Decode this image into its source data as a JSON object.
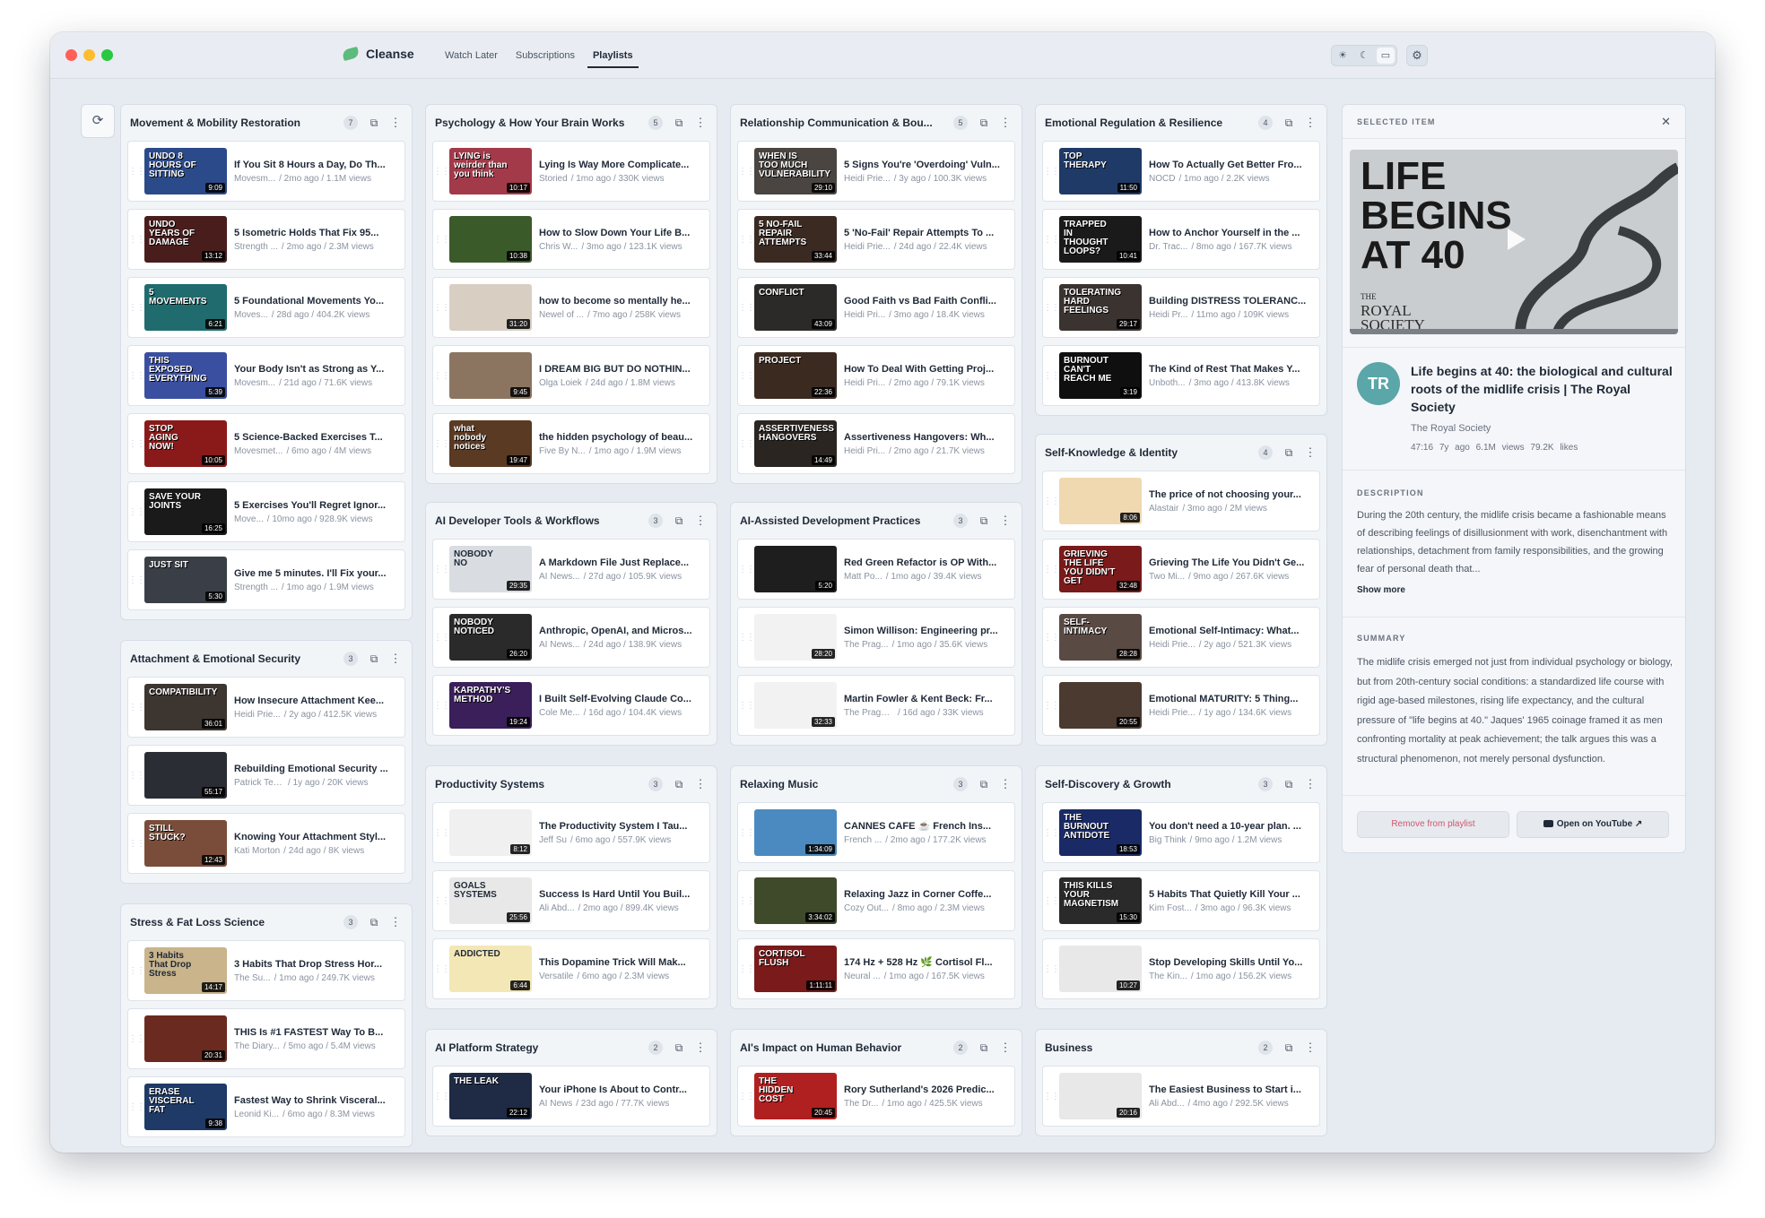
{
  "app": {
    "name": "Cleanse",
    "nav_tabs": [
      "Watch Later",
      "Subscriptions",
      "Playlists"
    ],
    "active_tab": "Playlists",
    "theme_icons": [
      "sun-icon",
      "moon-icon",
      "monitor-icon"
    ],
    "settings_icon": "gear-icon",
    "refresh_icon": "refresh-icon"
  },
  "playlists": [
    {
      "title": "Movement & Mobility Restoration",
      "count": "7",
      "items": [
        {
          "title": "If You Sit 8 Hours a Day, Do Th...",
          "channel": "Movesm...",
          "meta": "/ 2mo ago / 1.1M views",
          "duration": "9:09",
          "thumb_text": "UNDO 8 HOURS OF SITTING",
          "color": "#2b4a8a"
        },
        {
          "title": "5 Isometric Holds That Fix 95...",
          "channel": "Strength ...",
          "meta": "/ 2mo ago / 2.3M views",
          "duration": "13:12",
          "thumb_text": "UNDO YEARS OF DAMAGE",
          "color": "#4a1d1d"
        },
        {
          "title": "5 Foundational Movements Yo...",
          "channel": "Moves...",
          "meta": "/ 28d ago / 404.2K views",
          "duration": "6:21",
          "thumb_text": "5 MOVEMENTS",
          "color": "#1f6b6e"
        },
        {
          "title": "Your Body Isn't as Strong as Y...",
          "channel": "Movesm...",
          "meta": "/ 21d ago / 71.6K views",
          "duration": "5:39",
          "thumb_text": "THIS EXPOSED EVERYTHING",
          "color": "#3a4fa0"
        },
        {
          "title": "5 Science-Backed Exercises T...",
          "channel": "Movesmet...",
          "meta": "/ 6mo ago / 4M views",
          "duration": "10:05",
          "thumb_text": "STOP AGING NOW!",
          "color": "#8a1a1a"
        },
        {
          "title": "5 Exercises You'll Regret Ignor...",
          "channel": "Move...",
          "meta": "/ 10mo ago / 928.9K views",
          "duration": "16:25",
          "thumb_text": "SAVE YOUR JOINTS",
          "color": "#1a1a1a"
        },
        {
          "title": "Give me 5 minutes. I'll Fix your...",
          "channel": "Strength ...",
          "meta": "/ 1mo ago / 1.9M views",
          "duration": "5:30",
          "thumb_text": "JUST SIT",
          "color": "#3a3f47"
        }
      ]
    },
    {
      "title": "Attachment & Emotional Security",
      "count": "3",
      "items": [
        {
          "title": "How Insecure Attachment Kee...",
          "channel": "Heidi Prie...",
          "meta": "/ 2y ago / 412.5K views",
          "duration": "36:01",
          "thumb_text": "COMPATIBILITY",
          "color": "#3d3530"
        },
        {
          "title": "Rebuilding Emotional Security ...",
          "channel": "Patrick Teah...",
          "meta": "/ 1y ago / 20K views",
          "duration": "55:17",
          "thumb_text": "",
          "color": "#2a2d33"
        },
        {
          "title": "Knowing Your Attachment Styl...",
          "channel": "Kati Morton",
          "meta": "/ 24d ago / 8K views",
          "duration": "12:43",
          "thumb_text": "STILL STUCK?",
          "color": "#7a4d3a"
        }
      ]
    },
    {
      "title": "Stress & Fat Loss Science",
      "count": "3",
      "items": [
        {
          "title": "3 Habits That Drop Stress Hor...",
          "channel": "The Su...",
          "meta": "/ 1mo ago / 249.7K views",
          "duration": "14:17",
          "thumb_text": "3 Habits That Drop Stress",
          "color": "#c9b48c"
        },
        {
          "title": "THIS Is #1 FASTEST Way To B...",
          "channel": "The Diary...",
          "meta": "/ 5mo ago / 5.4M views",
          "duration": "20:31",
          "thumb_text": "",
          "color": "#6b2a20"
        },
        {
          "title": "Fastest Way to Shrink Visceral...",
          "channel": "Leonid Ki...",
          "meta": "/ 6mo ago / 8.3M views",
          "duration": "9:38",
          "thumb_text": "ERASE VISCERAL FAT",
          "color": "#1f3a66"
        }
      ]
    },
    {
      "title": "Psychology & How Your Brain Works",
      "count": "5",
      "items": [
        {
          "title": "Lying Is Way More Complicate...",
          "channel": "Storied",
          "meta": "/ 1mo ago / 330K views",
          "duration": "10:17",
          "thumb_text": "LYING is weirder than you think",
          "color": "#a33a4a"
        },
        {
          "title": "How to Slow Down Your Life B...",
          "channel": "Chris W...",
          "meta": "/ 3mo ago / 123.1K views",
          "duration": "10:38",
          "thumb_text": "",
          "color": "#3b5a2a"
        },
        {
          "title": "how to become so mentally he...",
          "channel": "Newel of ...",
          "meta": "/ 7mo ago / 258K views",
          "duration": "31:20",
          "thumb_text": "",
          "color": "#d8cfc2"
        },
        {
          "title": "I DREAM BIG BUT DO NOTHIN...",
          "channel": "Olga Loiek",
          "meta": "/ 24d ago / 1.8M views",
          "duration": "9:45",
          "thumb_text": "",
          "color": "#8c7560"
        },
        {
          "title": "the hidden psychology of beau...",
          "channel": "Five By N...",
          "meta": "/ 1mo ago / 1.9M views",
          "duration": "19:47",
          "thumb_text": "what nobody notices",
          "color": "#5a3a22"
        }
      ]
    },
    {
      "title": "AI Developer Tools & Workflows",
      "count": "3",
      "items": [
        {
          "title": "A Markdown File Just Replace...",
          "channel": "AI News...",
          "meta": "/ 27d ago / 105.9K views",
          "duration": "29:35",
          "thumb_text": "NOBODY NO",
          "color": "#d9dde2"
        },
        {
          "title": "Anthropic, OpenAI, and Micros...",
          "channel": "AI News...",
          "meta": "/ 24d ago / 138.9K views",
          "duration": "26:20",
          "thumb_text": "NOBODY NOTICED",
          "color": "#2a2a2a"
        },
        {
          "title": "I Built Self-Evolving Claude Co...",
          "channel": "Cole Me...",
          "meta": "/ 16d ago / 104.4K views",
          "duration": "19:24",
          "thumb_text": "KARPATHY'S METHOD",
          "color": "#3a1f5a"
        }
      ]
    },
    {
      "title": "Productivity Systems",
      "count": "3",
      "items": [
        {
          "title": "The Productivity System I Tau...",
          "channel": "Jeff Su",
          "meta": "/ 6mo ago / 557.9K views",
          "duration": "8:12",
          "thumb_text": "",
          "color": "#f0f0f0"
        },
        {
          "title": "Success Is Hard Until You Buil...",
          "channel": "Ali Abd...",
          "meta": "/ 2mo ago / 899.4K views",
          "duration": "25:56",
          "thumb_text": "GOALS SYSTEMS",
          "color": "#e8e8e8"
        },
        {
          "title": "This Dopamine Trick Will Mak...",
          "channel": "Versatile",
          "meta": "/ 6mo ago / 2.3M views",
          "duration": "6:44",
          "thumb_text": "ADDICTED",
          "color": "#f3e7b5"
        }
      ]
    },
    {
      "title": "AI Platform Strategy",
      "count": "2",
      "items": [
        {
          "title": "Your iPhone Is About to Contr...",
          "channel": "AI News",
          "meta": "/ 23d ago / 77.7K views",
          "duration": "22:12",
          "thumb_text": "THE LEAK",
          "color": "#1f2a44"
        }
      ]
    },
    {
      "title": "Relationship Communication & Bou...",
      "count": "5",
      "items": [
        {
          "title": "5 Signs You're 'Overdoing' Vuln...",
          "channel": "Heidi Prie...",
          "meta": "/ 3y ago / 100.3K views",
          "duration": "29:10",
          "thumb_text": "WHEN IS TOO MUCH VULNERABILITY",
          "color": "#4a4540"
        },
        {
          "title": "5 'No-Fail' Repair Attempts To ...",
          "channel": "Heidi Prie...",
          "meta": "/ 24d ago / 22.4K views",
          "duration": "33:44",
          "thumb_text": "5 NO-FAIL REPAIR ATTEMPTS",
          "color": "#3a2a22"
        },
        {
          "title": "Good Faith vs Bad Faith Confli...",
          "channel": "Heidi Pri...",
          "meta": "/ 3mo ago / 18.4K views",
          "duration": "43:09",
          "thumb_text": "CONFLICT",
          "color": "#2c2a28"
        },
        {
          "title": "How To Deal With Getting Proj...",
          "channel": "Heidi Pri...",
          "meta": "/ 2mo ago / 79.1K views",
          "duration": "22:36",
          "thumb_text": "PROJECT",
          "color": "#3a2a20"
        },
        {
          "title": "Assertiveness Hangovers: Wh...",
          "channel": "Heidi Pri...",
          "meta": "/ 2mo ago / 21.7K views",
          "duration": "14:49",
          "thumb_text": "ASSERTIVENESS HANGOVERS",
          "color": "#2a2520"
        }
      ]
    },
    {
      "title": "AI-Assisted Development Practices",
      "count": "3",
      "items": [
        {
          "title": "Red Green Refactor is OP With...",
          "channel": "Matt Po...",
          "meta": "/ 1mo ago / 39.4K views",
          "duration": "5:20",
          "thumb_text": "",
          "color": "#1e1e1e"
        },
        {
          "title": "Simon Willison: Engineering pr...",
          "channel": "The Prag...",
          "meta": "/ 1mo ago / 35.6K views",
          "duration": "28:20",
          "thumb_text": "",
          "color": "#f2f2f2"
        },
        {
          "title": "Martin Fowler & Kent Beck: Fr...",
          "channel": "The Pragm...",
          "meta": "/ 16d ago / 33K views",
          "duration": "32:33",
          "thumb_text": "",
          "color": "#f2f2f2"
        }
      ]
    },
    {
      "title": "Relaxing Music",
      "count": "3",
      "items": [
        {
          "title": "CANNES CAFE ☕ French Ins...",
          "channel": "French ...",
          "meta": "/ 2mo ago / 177.2K views",
          "duration": "1:34:09",
          "thumb_text": "",
          "color": "#4a8ac0"
        },
        {
          "title": "Relaxing Jazz in Corner Coffe...",
          "channel": "Cozy Out...",
          "meta": "/ 8mo ago / 2.3M views",
          "duration": "3:34:02",
          "thumb_text": "",
          "color": "#3f4a2a"
        },
        {
          "title": "174 Hz + 528 Hz 🌿 Cortisol Fl...",
          "channel": "Neural ...",
          "meta": "/ 1mo ago / 167.5K views",
          "duration": "1:11:11",
          "thumb_text": "CORTISOL FLUSH",
          "color": "#7a1a1a"
        }
      ]
    },
    {
      "title": "AI's Impact on Human Behavior",
      "count": "2",
      "items": [
        {
          "title": "Rory Sutherland's 2026 Predic...",
          "channel": "The Dr...",
          "meta": "/ 1mo ago / 425.5K views",
          "duration": "20:45",
          "thumb_text": "THE HIDDEN COST",
          "color": "#b02020"
        }
      ]
    },
    {
      "title": "Emotional Regulation & Resilience",
      "count": "4",
      "items": [
        {
          "title": "How To Actually Get Better Fro...",
          "channel": "NOCD",
          "meta": "/ 1mo ago / 2.2K views",
          "duration": "11:50",
          "thumb_text": "TOP THERAPY",
          "color": "#1f3a66"
        },
        {
          "title": "How to Anchor Yourself in the ...",
          "channel": "Dr. Trac...",
          "meta": "/ 8mo ago / 167.7K views",
          "duration": "10:41",
          "thumb_text": "TRAPPED IN THOUGHT LOOPS?",
          "color": "#1a1a1a"
        },
        {
          "title": "Building DISTRESS TOLERANC...",
          "channel": "Heidi Pr...",
          "meta": "/ 11mo ago / 109K views",
          "duration": "29:17",
          "thumb_text": "TOLERATING HARD FEELINGS",
          "color": "#3a3330"
        },
        {
          "title": "The Kind of Rest That Makes Y...",
          "channel": "Unboth...",
          "meta": "/ 3mo ago / 413.8K views",
          "duration": "3:19",
          "thumb_text": "BURNOUT CAN'T REACH ME",
          "color": "#0f0f0f"
        }
      ]
    },
    {
      "title": "Self-Knowledge & Identity",
      "count": "4",
      "items": [
        {
          "title": "The price of not choosing your...",
          "channel": "Alastair",
          "meta": "/ 3mo ago / 2M views",
          "duration": "8:06",
          "thumb_text": "",
          "color": "#f0d8b0"
        },
        {
          "title": "Grieving The Life You Didn't Ge...",
          "channel": "Two Mi...",
          "meta": "/ 9mo ago / 267.6K views",
          "duration": "32:48",
          "thumb_text": "GRIEVING THE LIFE YOU DIDN'T GET",
          "color": "#7a1a1a"
        },
        {
          "title": "Emotional Self-Intimacy: What...",
          "channel": "Heidi Prie...",
          "meta": "/ 2y ago / 521.3K views",
          "duration": "28:28",
          "thumb_text": "SELF-INTIMACY",
          "color": "#5a4a44"
        },
        {
          "title": "Emotional MATURITY: 5 Thing...",
          "channel": "Heidi Prie...",
          "meta": "/ 1y ago / 134.6K views",
          "duration": "20:55",
          "thumb_text": "",
          "color": "#4a3a30"
        }
      ]
    },
    {
      "title": "Self-Discovery & Growth",
      "count": "3",
      "items": [
        {
          "title": "You don't need a 10-year plan. ...",
          "channel": "Big Think",
          "meta": "/ 9mo ago / 1.2M views",
          "duration": "18:53",
          "thumb_text": "THE BURNOUT ANTIDOTE",
          "color": "#1a2a66"
        },
        {
          "title": "5 Habits That Quietly Kill Your ...",
          "channel": "Kim Fost...",
          "meta": "/ 3mo ago / 96.3K views",
          "duration": "15:30",
          "thumb_text": "THIS KILLS YOUR MAGNETISM",
          "color": "#2a2a2a"
        },
        {
          "title": "Stop Developing Skills Until Yo...",
          "channel": "The Kin...",
          "meta": "/ 1mo ago / 156.2K views",
          "duration": "10:27",
          "thumb_text": "",
          "color": "#e8e8e8"
        }
      ]
    },
    {
      "title": "Business",
      "count": "2",
      "items": [
        {
          "title": "The Easiest Business to Start i...",
          "channel": "Ali Abd...",
          "meta": "/ 4mo ago / 292.5K views",
          "duration": "20:16",
          "thumb_text": "",
          "color": "#e8e8e8"
        }
      ]
    }
  ],
  "detail": {
    "label": "SELECTED ITEM",
    "thumb_text_line1": "LIFE",
    "thumb_text_line2": "BEGINS",
    "thumb_text_line3": "AT 40",
    "thumb_brand_line1": "THE",
    "thumb_brand_line2": "ROYAL",
    "thumb_brand_line3": "SOCIETY",
    "avatar": "TR",
    "title": "Life begins at 40: the biological and cultural roots of the midlife crisis | The Royal Society",
    "channel": "The Royal Society",
    "duration": "47:16",
    "age": "7y ago",
    "views": "6.1M views",
    "likes": "79.2K likes",
    "description_label": "DESCRIPTION",
    "description": "During the 20th century, the midlife crisis became a fashionable means of describing feelings of disillusionment with work, disenchantment with relationships, detachment from family responsibilities, and the growing fear of personal death that...",
    "show_more": "Show more",
    "summary_label": "SUMMARY",
    "summary": "The midlife crisis emerged not just from individual psychology or biology, but from 20th-century social conditions: a standardized life course with rigid age-based milestones, rising life expectancy, and the cultural pressure of \"life begins at 40.\" Jaques' 1965 coinage framed it as men confronting mortality at peak achievement; the talk argues this was a structural phenomenon, not merely personal dysfunction.",
    "remove_label": "Remove from playlist",
    "youtube_label": "Open on YouTube ↗"
  }
}
